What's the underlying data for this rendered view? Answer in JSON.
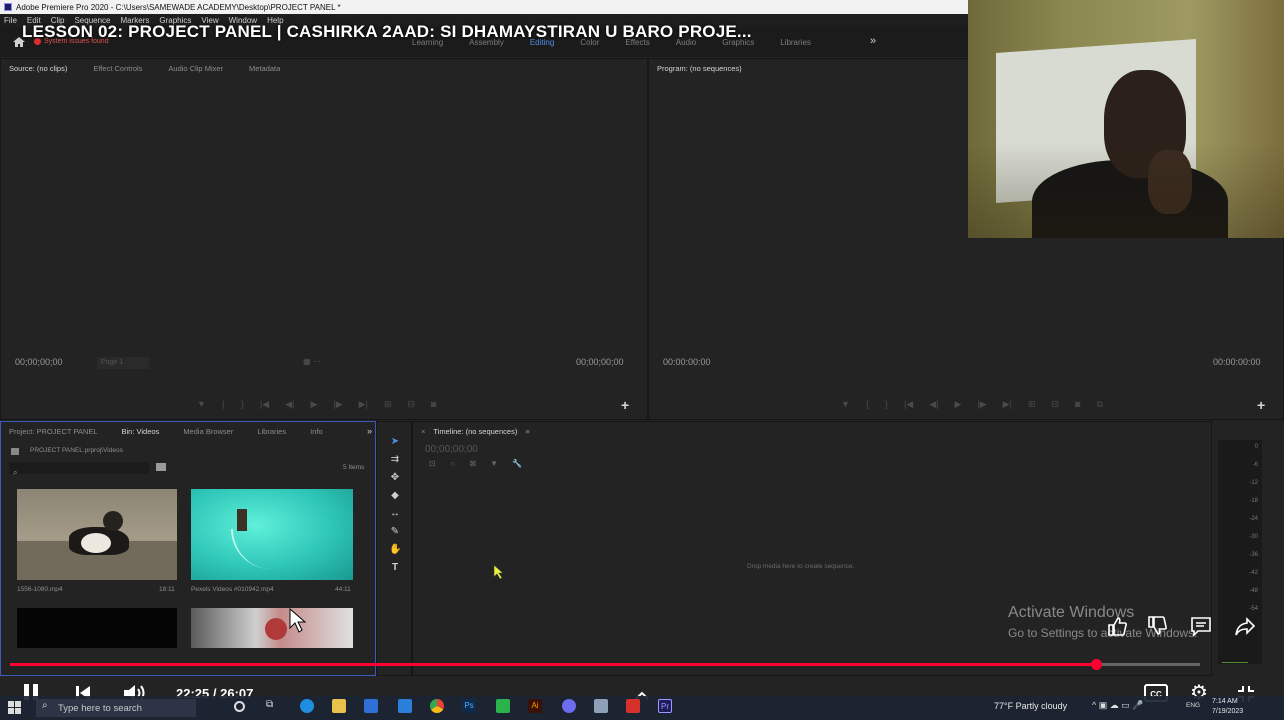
{
  "window": {
    "title": "Adobe Premiere Pro 2020 - C:\\Users\\SAMEWADE ACADEMY\\Desktop\\PROJECT PANEL *"
  },
  "menu": [
    "File",
    "Edit",
    "Clip",
    "Sequence",
    "Markers",
    "Graphics",
    "View",
    "Window",
    "Help"
  ],
  "workspaces": {
    "tabs": [
      "Learning",
      "Assembly",
      "Editing",
      "Color",
      "Effects",
      "Audio",
      "Graphics",
      "Libraries"
    ],
    "active": "Editing"
  },
  "overlay": {
    "lesson_title": "LESSON 02: PROJECT PANEL | CASHIRKA 2AAD: SI DHAMAYSTIRAN U BARO PROJE...",
    "system_issue": "System issues found"
  },
  "source_panel": {
    "tabs": [
      "Source: (no clips)",
      "Effect Controls",
      "Audio Clip Mixer",
      "Metadata"
    ],
    "timecode_left": "00;00;00;00",
    "timecode_right": "00;00;00;00",
    "fit_value": "Page 1"
  },
  "program_panel": {
    "tab": "Program: (no sequences)",
    "timecode_left": "00:00:00:00",
    "timecode_right": "00:00:00:00"
  },
  "project_panel": {
    "tabs": [
      "Project: PROJECT PANEL",
      "Bin: Videos",
      "Media Browser",
      "Libraries",
      "Info"
    ],
    "path": "PROJECT PANEL.prproj\\Videos",
    "item_count": "5 Items",
    "clips": [
      {
        "name": "1556-1080.mp4",
        "duration": "18:11"
      },
      {
        "name": "Pexels Videos #010942.mp4",
        "duration": "44:11"
      },
      {
        "name": "",
        "duration": ""
      },
      {
        "name": "",
        "duration": ""
      }
    ]
  },
  "timeline": {
    "tab": "Timeline: (no sequences)",
    "timecode": "00;00;00;00",
    "empty_message": "Drop media here to create sequence."
  },
  "meter_labels": [
    "0",
    "-6",
    "-12",
    "-18",
    "-24",
    "-30",
    "-36",
    "-42",
    "-48",
    "-54"
  ],
  "watermark": {
    "line1": "Activate Windows",
    "line2": "Go to Settings to activate Windows."
  },
  "player": {
    "time": "22:25 / 26:07",
    "progress": 0.913
  },
  "taskbar": {
    "search_placeholder": "Type here to search",
    "weather": "77°F  Partly cloudy",
    "language": "ENG",
    "clock_time": "7:14 AM",
    "clock_date": "7/19/2023"
  }
}
